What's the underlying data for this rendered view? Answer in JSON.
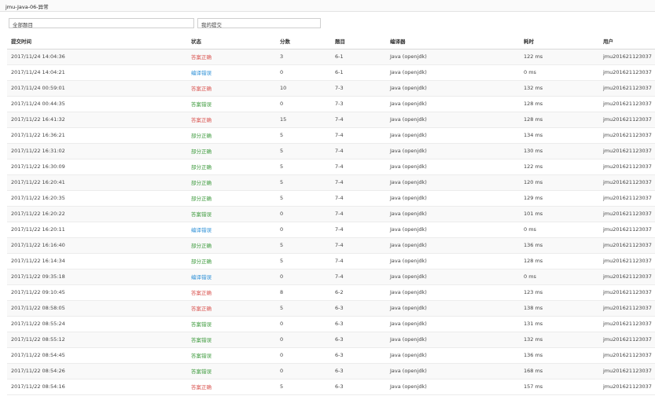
{
  "page": {
    "title": "jmu-Java-06-异常"
  },
  "filters": {
    "all_problems": "全部题目",
    "my_submissions": "我的提交"
  },
  "table": {
    "headers": {
      "time": "提交时间",
      "status": "状态",
      "score": "分数",
      "problem": "题目",
      "compiler": "编译器",
      "elapsed": "耗时",
      "user": "用户"
    },
    "status_colors": {
      "答案正确": "#d9534f",
      "部分正确": "#3c9a3c",
      "编译错误": "#2b8fd6",
      "答案错误": "#3c9a3c"
    },
    "rows": [
      {
        "time": "2017/11/24 14:04:36",
        "status": "答案正确",
        "score": "3",
        "problem": "6-1",
        "compiler": "Java (openjdk)",
        "elapsed": "122 ms",
        "user": "jmu201621123037"
      },
      {
        "time": "2017/11/24 14:04:21",
        "status": "编译错误",
        "score": "0",
        "problem": "6-1",
        "compiler": "Java (openjdk)",
        "elapsed": "0 ms",
        "user": "jmu201621123037"
      },
      {
        "time": "2017/11/24 00:59:01",
        "status": "答案正确",
        "score": "10",
        "problem": "7-3",
        "compiler": "Java (openjdk)",
        "elapsed": "132 ms",
        "user": "jmu201621123037"
      },
      {
        "time": "2017/11/24 00:44:35",
        "status": "答案错误",
        "score": "0",
        "problem": "7-3",
        "compiler": "Java (openjdk)",
        "elapsed": "128 ms",
        "user": "jmu201621123037"
      },
      {
        "time": "2017/11/22 16:41:32",
        "status": "答案正确",
        "score": "15",
        "problem": "7-4",
        "compiler": "Java (openjdk)",
        "elapsed": "128 ms",
        "user": "jmu201621123037"
      },
      {
        "time": "2017/11/22 16:36:21",
        "status": "部分正确",
        "score": "5",
        "problem": "7-4",
        "compiler": "Java (openjdk)",
        "elapsed": "134 ms",
        "user": "jmu201621123037"
      },
      {
        "time": "2017/11/22 16:31:02",
        "status": "部分正确",
        "score": "5",
        "problem": "7-4",
        "compiler": "Java (openjdk)",
        "elapsed": "130 ms",
        "user": "jmu201621123037"
      },
      {
        "time": "2017/11/22 16:30:09",
        "status": "部分正确",
        "score": "5",
        "problem": "7-4",
        "compiler": "Java (openjdk)",
        "elapsed": "122 ms",
        "user": "jmu201621123037"
      },
      {
        "time": "2017/11/22 16:20:41",
        "status": "部分正确",
        "score": "5",
        "problem": "7-4",
        "compiler": "Java (openjdk)",
        "elapsed": "120 ms",
        "user": "jmu201621123037"
      },
      {
        "time": "2017/11/22 16:20:35",
        "status": "部分正确",
        "score": "5",
        "problem": "7-4",
        "compiler": "Java (openjdk)",
        "elapsed": "129 ms",
        "user": "jmu201621123037"
      },
      {
        "time": "2017/11/22 16:20:22",
        "status": "答案错误",
        "score": "0",
        "problem": "7-4",
        "compiler": "Java (openjdk)",
        "elapsed": "101 ms",
        "user": "jmu201621123037"
      },
      {
        "time": "2017/11/22 16:20:11",
        "status": "编译错误",
        "score": "0",
        "problem": "7-4",
        "compiler": "Java (openjdk)",
        "elapsed": "0 ms",
        "user": "jmu201621123037"
      },
      {
        "time": "2017/11/22 16:16:40",
        "status": "部分正确",
        "score": "5",
        "problem": "7-4",
        "compiler": "Java (openjdk)",
        "elapsed": "136 ms",
        "user": "jmu201621123037"
      },
      {
        "time": "2017/11/22 16:14:34",
        "status": "部分正确",
        "score": "5",
        "problem": "7-4",
        "compiler": "Java (openjdk)",
        "elapsed": "128 ms",
        "user": "jmu201621123037"
      },
      {
        "time": "2017/11/22 09:35:18",
        "status": "编译错误",
        "score": "0",
        "problem": "7-4",
        "compiler": "Java (openjdk)",
        "elapsed": "0 ms",
        "user": "jmu201621123037"
      },
      {
        "time": "2017/11/22 09:10:45",
        "status": "答案正确",
        "score": "8",
        "problem": "6-2",
        "compiler": "Java (openjdk)",
        "elapsed": "123 ms",
        "user": "jmu201621123037"
      },
      {
        "time": "2017/11/22 08:58:05",
        "status": "答案正确",
        "score": "5",
        "problem": "6-3",
        "compiler": "Java (openjdk)",
        "elapsed": "138 ms",
        "user": "jmu201621123037"
      },
      {
        "time": "2017/11/22 08:55:24",
        "status": "答案错误",
        "score": "0",
        "problem": "6-3",
        "compiler": "Java (openjdk)",
        "elapsed": "131 ms",
        "user": "jmu201621123037"
      },
      {
        "time": "2017/11/22 08:55:12",
        "status": "答案错误",
        "score": "0",
        "problem": "6-3",
        "compiler": "Java (openjdk)",
        "elapsed": "132 ms",
        "user": "jmu201621123037"
      },
      {
        "time": "2017/11/22 08:54:45",
        "status": "答案错误",
        "score": "0",
        "problem": "6-3",
        "compiler": "Java (openjdk)",
        "elapsed": "136 ms",
        "user": "jmu201621123037"
      },
      {
        "time": "2017/11/22 08:54:26",
        "status": "答案错误",
        "score": "0",
        "problem": "6-3",
        "compiler": "Java (openjdk)",
        "elapsed": "168 ms",
        "user": "jmu201621123037"
      },
      {
        "time": "2017/11/22 08:54:16",
        "status": "答案正确",
        "score": "5",
        "problem": "6-3",
        "compiler": "Java (openjdk)",
        "elapsed": "157 ms",
        "user": "jmu201621123037"
      }
    ]
  }
}
